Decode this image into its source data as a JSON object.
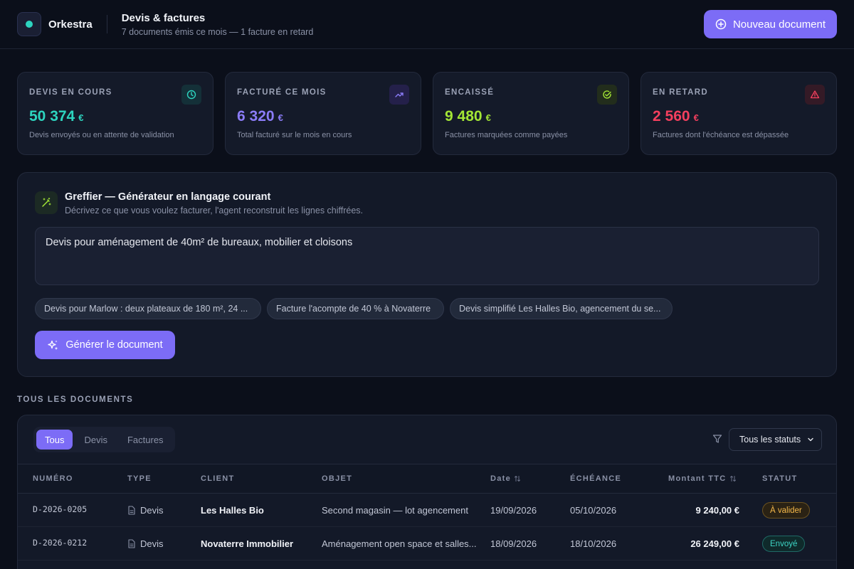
{
  "app": {
    "name": "Orkestra"
  },
  "header": {
    "title": "Devis & factures",
    "subtitle": "7 documents émis ce mois — 1 facture en retard",
    "new_button": "Nouveau document"
  },
  "stats": [
    {
      "label": "DEVIS EN COURS",
      "value": "50 374",
      "currency": "€",
      "desc": "Devis envoyés ou en attente de validation",
      "color": "#2dd4bf",
      "icon": "clock-icon"
    },
    {
      "label": "FACTURÉ CE MOIS",
      "value": "6 320",
      "currency": "€",
      "desc": "Total facturé sur le mois en cours",
      "color": "#8b7cf8",
      "icon": "trending-up-icon"
    },
    {
      "label": "ENCAISSÉ",
      "value": "9 480",
      "currency": "€",
      "desc": "Factures marquées comme payées",
      "color": "#a3e635",
      "icon": "check-circle-icon"
    },
    {
      "label": "EN RETARD",
      "value": "2 560",
      "currency": "€",
      "desc": "Factures dont l'échéance est dépassée",
      "color": "#f43f5e",
      "icon": "alert-triangle-icon"
    }
  ],
  "generator": {
    "title": "Greffier — Générateur en langage courant",
    "subtitle": "Décrivez ce que vous voulez facturer, l'agent reconstruit les lignes chiffrées.",
    "input_value": "Devis pour aménagement de 40m² de bureaux, mobilier et cloisons",
    "suggestions": [
      "Devis pour Marlow : deux plateaux de 180 m², 24 ...",
      "Facture l'acompte de 40 % à Novaterre",
      "Devis simplifié Les Halles Bio, agencement du se..."
    ],
    "button": "Générer le document"
  },
  "documents": {
    "section_label": "TOUS LES DOCUMENTS",
    "tabs": [
      "Tous",
      "Devis",
      "Factures"
    ],
    "active_tab": "Tous",
    "status_filter": "Tous les statuts",
    "columns": {
      "numero": "NUMÉRO",
      "type": "TYPE",
      "client": "CLIENT",
      "objet": "OBJET",
      "date": "Date",
      "echeance": "ÉCHÉANCE",
      "montant": "Montant TTC",
      "statut": "STATUT"
    },
    "rows": [
      {
        "numero": "D-2026-0205",
        "type": "Devis",
        "client": "Les Halles Bio",
        "objet": "Second magasin — lot agencement",
        "date": "19/09/2026",
        "echeance": "05/10/2026",
        "montant": "9 240,00 €",
        "statut": "À valider"
      },
      {
        "numero": "D-2026-0212",
        "type": "Devis",
        "client": "Novaterre Immobilier",
        "objet": "Aménagement open space et salles...",
        "date": "18/09/2026",
        "echeance": "18/10/2026",
        "montant": "26 249,00 €",
        "statut": "Envoyé"
      }
    ]
  }
}
